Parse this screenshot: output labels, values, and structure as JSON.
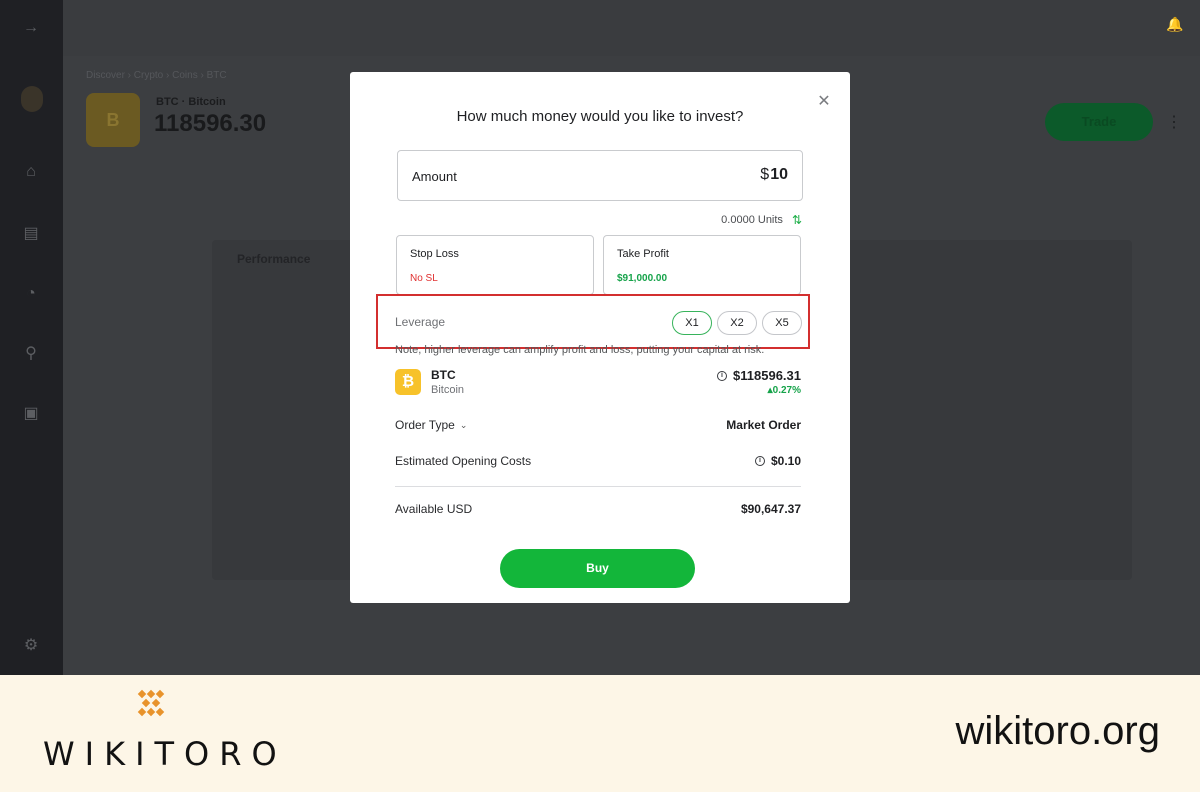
{
  "background": {
    "breadcrumb": "Discover  ›  Crypto  ›  Coins  ›  BTC",
    "asset": {
      "symbol": "BTC",
      "name": "Bitcoin",
      "price": "118596.30",
      "logo_glyph": "B"
    },
    "trade_label": "Trade",
    "performance_label": "Performance"
  },
  "modal": {
    "title": "How much money would you like to invest?",
    "amount": {
      "label": "Amount",
      "currency": "$",
      "value": "10"
    },
    "units": "0.0000 Units",
    "stop_loss": {
      "label": "Stop Loss",
      "value": "No SL"
    },
    "take_profit": {
      "label": "Take Profit",
      "value": "$91,000.00"
    },
    "leverage": {
      "label": "Leverage",
      "options": [
        "X1",
        "X2",
        "X5"
      ],
      "selected": "X1",
      "note": "Note, higher leverage can amplify profit and loss, putting your capital at risk."
    },
    "instrument": {
      "symbol": "BTC",
      "name": "Bitcoin",
      "price": "$118596.31",
      "change": "0.27%",
      "change_prefix": "▴"
    },
    "order_type": {
      "label": "Order Type",
      "value": "Market Order"
    },
    "opening_costs": {
      "label": "Estimated Opening Costs",
      "value": "$0.10"
    },
    "available": {
      "label": "Available USD",
      "value": "$90,647.37"
    },
    "buy_label": "Buy"
  },
  "footer": {
    "brand": "WIKITORO",
    "url": "wikitoro.org"
  },
  "colors": {
    "accent_green": "#13b63a",
    "profit_green": "#16a34a",
    "loss_red": "#e03030",
    "highlight_red": "#d32f2f",
    "btc_yellow": "#f7c22a",
    "footer_bg": "#fdf6e7"
  }
}
